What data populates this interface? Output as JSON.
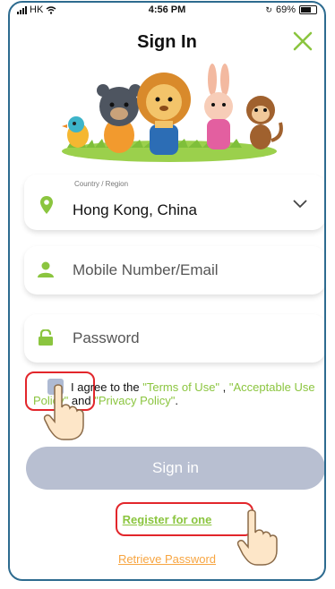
{
  "status_bar": {
    "carrier": "HK",
    "time": "4:56 PM",
    "battery": "69%"
  },
  "header": {
    "title": "Sign In"
  },
  "country": {
    "label": "Country / Region",
    "value": "Hong Kong, China"
  },
  "mobile": {
    "placeholder": "Mobile Number/Email"
  },
  "password": {
    "placeholder": "Password"
  },
  "agreement": {
    "prefix": "I agree to the ",
    "terms": "\"Terms of Use\"",
    "sep1": " , ",
    "aup": "\"Acceptable Use Policy\"",
    "and": " and ",
    "privacy": "\"Privacy Policy\"",
    "suffix": ".",
    "checked": false
  },
  "buttons": {
    "sign_in": "Sign in"
  },
  "links": {
    "register": "Register for one",
    "retrieve": "Retrieve Password"
  },
  "colors": {
    "accent_green": "#8bc53f",
    "orange": "#f7a541",
    "button_disabled": "#b8bfd1",
    "highlight_red": "#e2262b"
  }
}
